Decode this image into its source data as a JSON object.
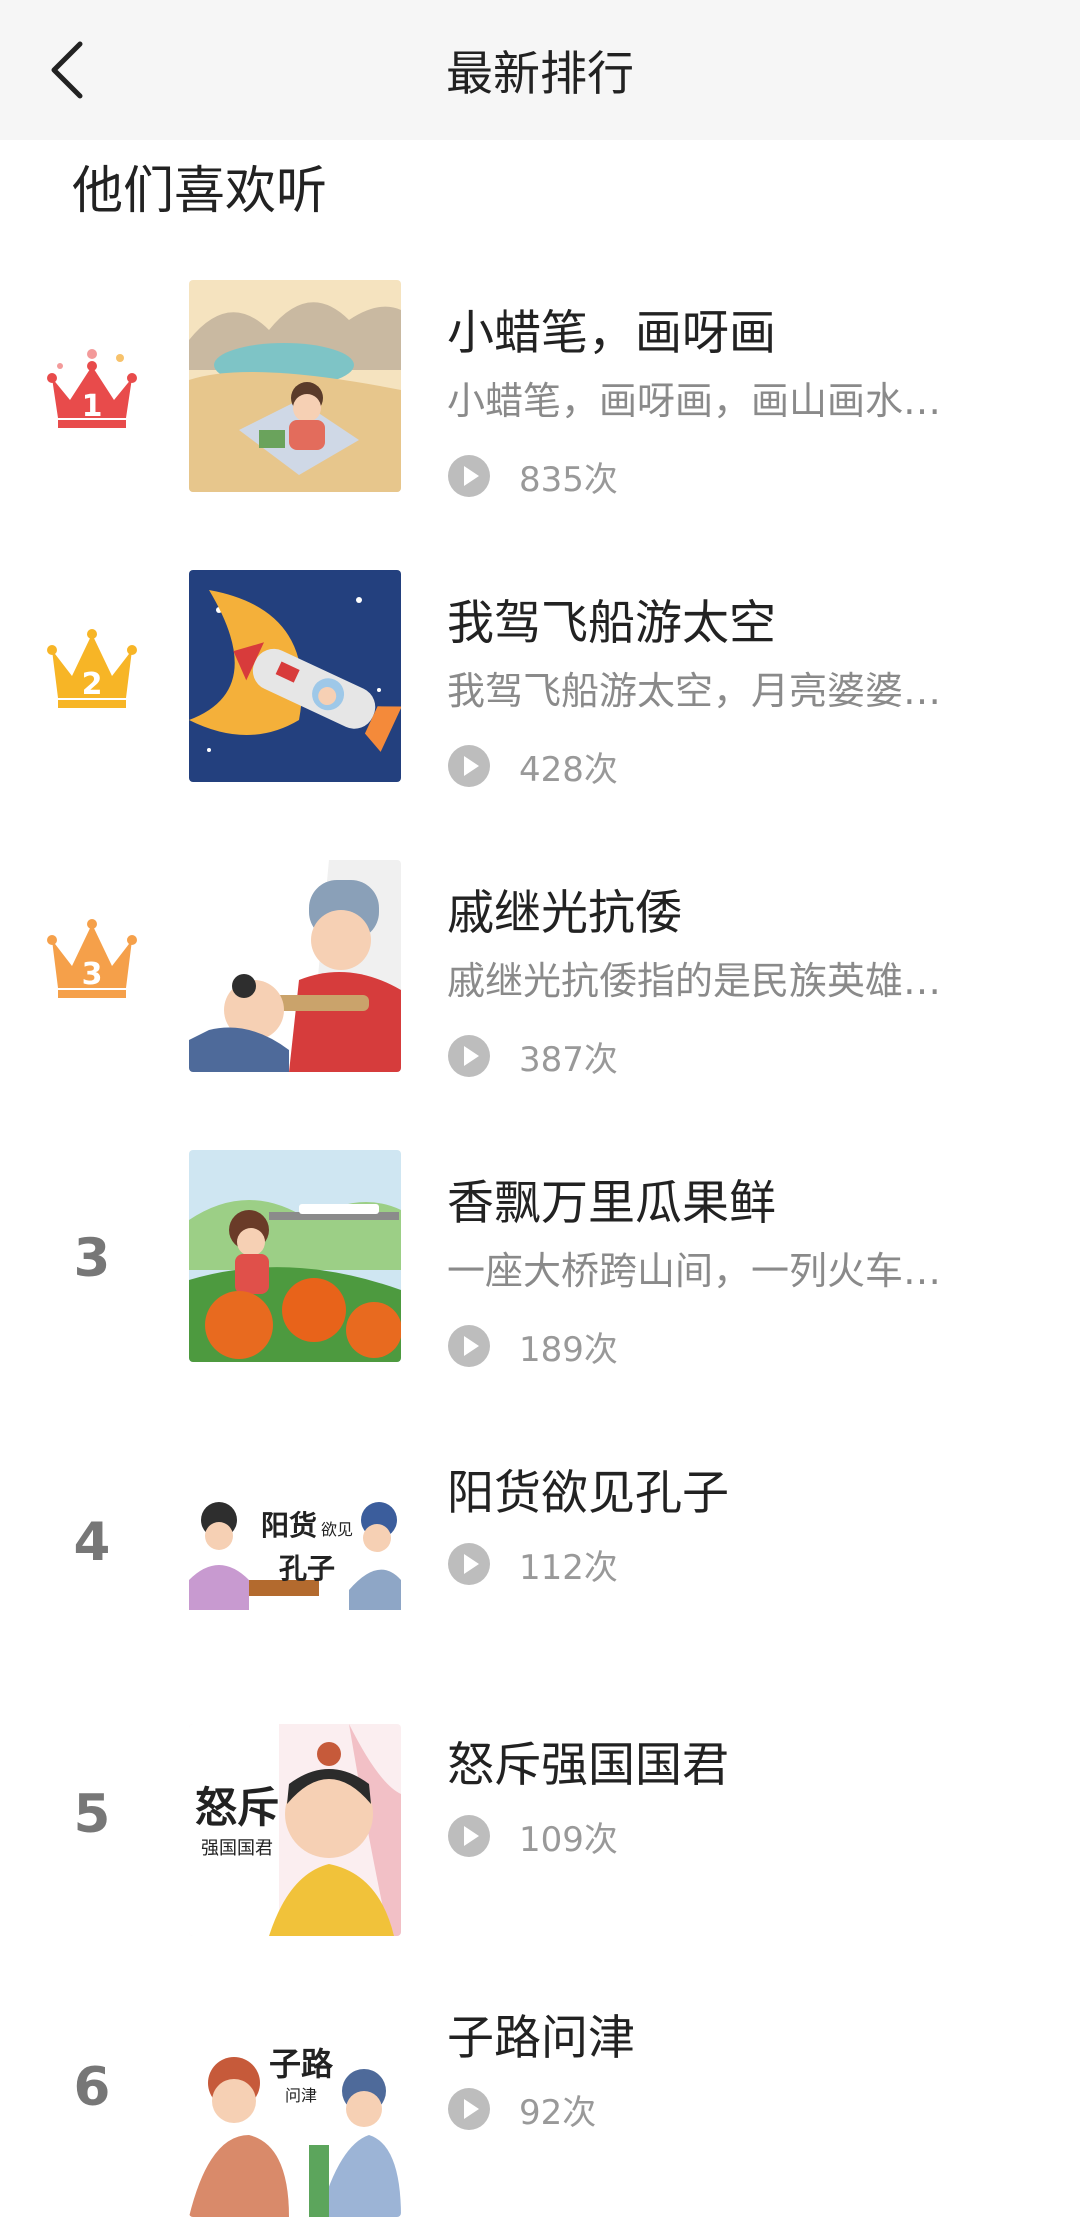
{
  "header": {
    "title": "最新排行",
    "back_icon": "chevron-left-icon"
  },
  "section_title": "他们喜欢听",
  "colors": {
    "gold_crown": "#f7b526",
    "red_crown": "#e84b4b",
    "orange_crown": "#f5a04a",
    "rank_gray": "#777777"
  },
  "items": [
    {
      "rank": "1",
      "title": "小蜡笔，画呀画",
      "desc": "小蜡笔，画呀画，画山画水…",
      "plays": "835次"
    },
    {
      "rank": "2",
      "title": "我驾飞船游太空",
      "desc": "我驾飞船游太空，月亮婆婆…",
      "plays": "428次"
    },
    {
      "rank": "3",
      "title": "戚继光抗倭",
      "desc": "戚继光抗倭指的是民族英雄…",
      "plays": "387次"
    },
    {
      "rank": "3",
      "title": "香飘万里瓜果鲜",
      "desc": "一座大桥跨山间，一列火车…",
      "plays": "189次"
    },
    {
      "rank": "4",
      "title": "阳货欲见孔子",
      "desc": "",
      "plays": "112次",
      "cover_text": [
        "阳货",
        "欲见",
        "孔子"
      ]
    },
    {
      "rank": "5",
      "title": "怒斥强国国君",
      "desc": "",
      "plays": "109次",
      "cover_text": [
        "怒斥",
        "强国国君"
      ]
    },
    {
      "rank": "6",
      "title": "子路问津",
      "desc": "",
      "plays": "92次",
      "cover_text": [
        "子路",
        "问津"
      ]
    }
  ]
}
